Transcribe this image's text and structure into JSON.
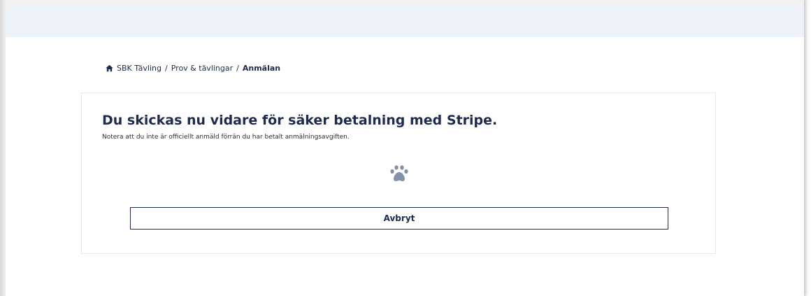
{
  "breadcrumb": {
    "items": [
      "SBK Tävling",
      "Prov & tävlingar"
    ],
    "separator": "/",
    "current": "Anmälan",
    "icon": "home-icon"
  },
  "main": {
    "title": "Du skickas nu vidare för säker betalning med Stripe.",
    "note": "Notera att du inte är officiellt anmäld förrän du har betalt anmälningsavgiften.",
    "loader_icon": "paw-icon",
    "cancel_label": "Avbryt"
  },
  "colors": {
    "brand": "#1c2b4f",
    "topbar": "#edf2f9",
    "paw": "#8391ab"
  }
}
